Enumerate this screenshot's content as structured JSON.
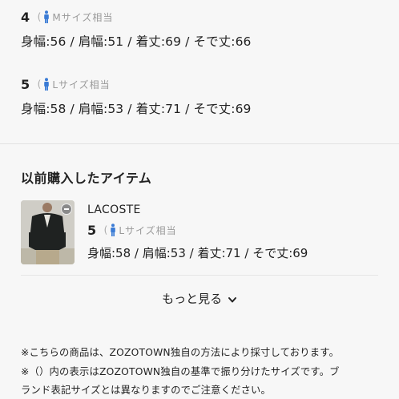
{
  "sizes": [
    {
      "num": "4",
      "paren_open": "(",
      "equiv": "Mサイズ相当",
      "measures": "身幅:56 / 肩幅:51 / 着丈:69 / そで丈:66"
    },
    {
      "num": "5",
      "paren_open": "(",
      "equiv": "Lサイズ相当",
      "measures": "身幅:58 / 肩幅:53 / 着丈:71 / そで丈:69"
    }
  ],
  "purchased": {
    "title": "以前購入したアイテム",
    "items": [
      {
        "brand": "LACOSTE",
        "num": "5",
        "paren_open": "(",
        "equiv": "Lサイズ相当",
        "measures": "身幅:58 / 肩幅:53 / 着丈:71 / そで丈:69"
      }
    ],
    "more_label": "もっと見る"
  },
  "notes": [
    "※こちらの商品は、ZOZOTOWN独自の方法により採寸しております。",
    "※（）内の表示はZOZOTOWN独自の基準で振り分けたサイズです。ブ",
    "ランド表記サイズとは異なりますのでご注意ください。"
  ],
  "colors": {
    "person_icon": "#3a7bd5",
    "accent_text": "#222222",
    "muted": "#999999"
  },
  "icons": {
    "person": "person-icon",
    "chevron": "chevron-down-icon",
    "thumb_badge": "minus-badge-icon"
  }
}
